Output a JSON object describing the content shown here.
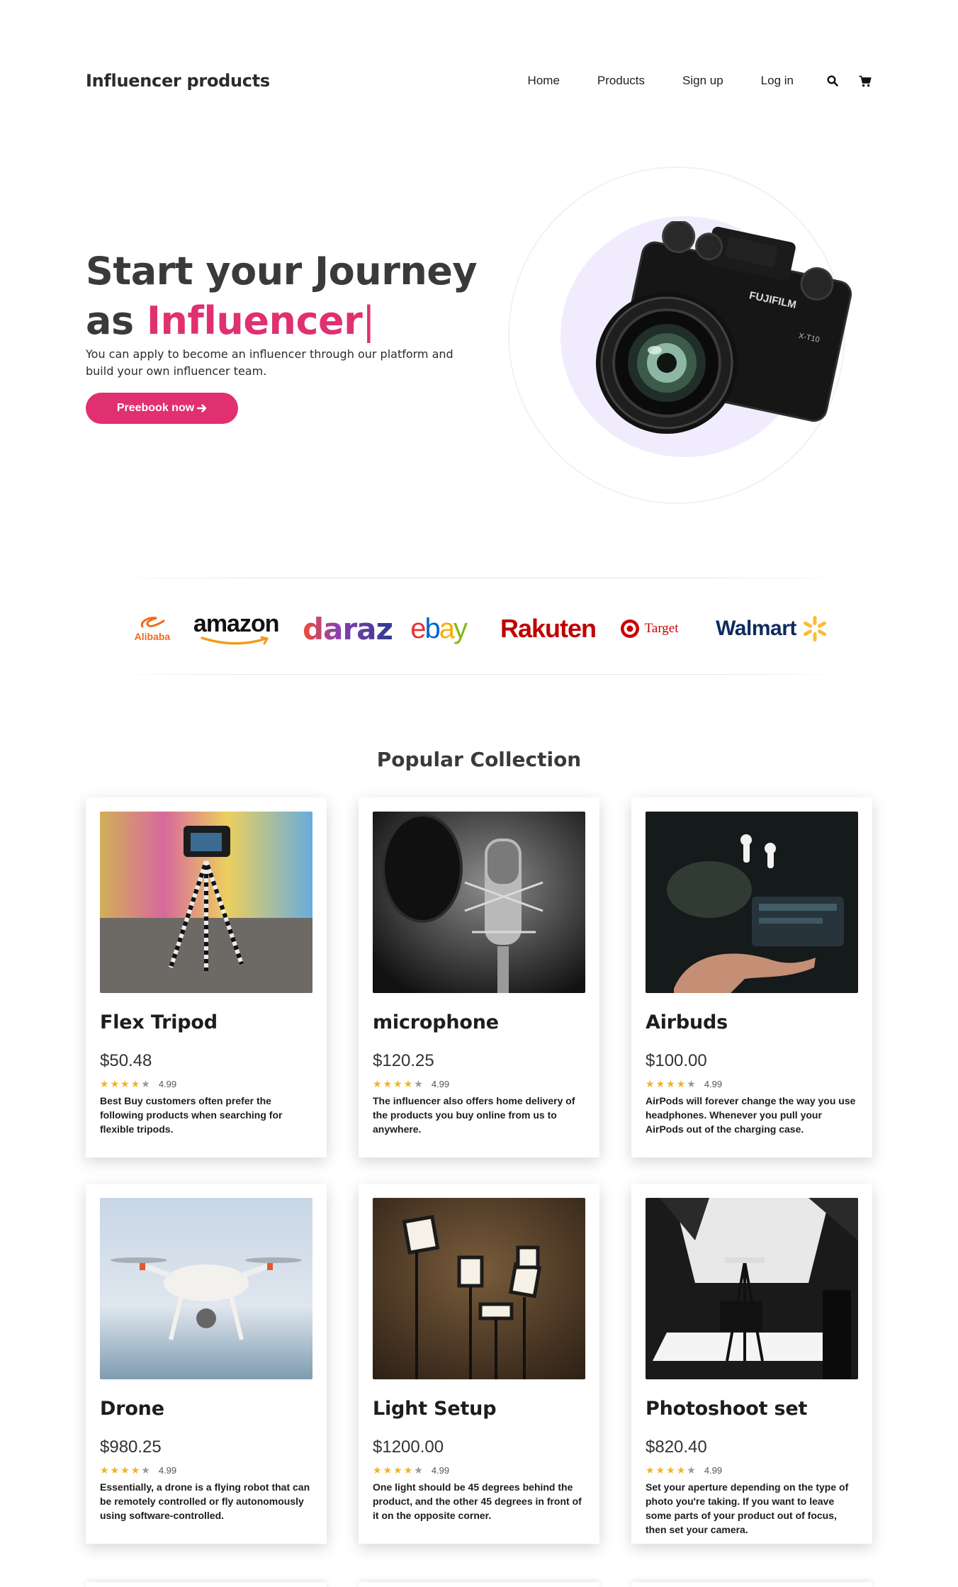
{
  "nav": {
    "brand": "Influencer products",
    "links": [
      "Home",
      "Products",
      "Sign up",
      "Log in"
    ],
    "icons": [
      "search-icon",
      "cart-icon"
    ]
  },
  "hero": {
    "title_line1": "Start your Journey",
    "title_line2_prefix": "as ",
    "title_accent": "Influencer",
    "cursor": "|",
    "subtitle": "You can apply to become an influencer through our platform and build your own influencer team.",
    "button_label": "Preebook now",
    "image": "camera-image"
  },
  "brands": {
    "alibaba": "Alibaba",
    "amazon": "amazon",
    "daraz": "daraz",
    "ebay": "ebay",
    "rakuten": "Rakuten",
    "target": "Target",
    "walmart": "Walmart"
  },
  "collection": {
    "title": "Popular Collection",
    "products": [
      {
        "name": "Flex Tripod",
        "price": "$50.48",
        "rating": "4.99",
        "stars": 4,
        "description": "Best Buy customers often prefer the following products when searching for flexible tripods."
      },
      {
        "name": "microphone",
        "price": "$120.25",
        "rating": "4.99",
        "stars": 4,
        "description": "The influencer also offers home delivery of the products you buy online from us to anywhere."
      },
      {
        "name": "Airbuds",
        "price": "$100.00",
        "rating": "4.99",
        "stars": 4,
        "description": "AirPods will forever change the way you use headphones. Whenever you pull your AirPods out of the charging case."
      },
      {
        "name": "Drone",
        "price": "$980.25",
        "rating": "4.99",
        "stars": 4,
        "description": "Essentially, a drone is a flying robot that can be remotely controlled or fly autonomously using software-controlled."
      },
      {
        "name": "Light Setup",
        "price": "$1200.00",
        "rating": "4.99",
        "stars": 4,
        "description": "One light should be 45 degrees behind the product, and the other 45 degrees in front of it on the opposite corner."
      },
      {
        "name": "Photoshoot set",
        "price": "$820.40",
        "rating": "4.99",
        "stars": 4,
        "description": "Set your aperture depending on the type of photo you're taking. If you want to leave some parts of your product out of focus, then set your camera."
      }
    ]
  },
  "colors": {
    "accent": "#e0306f",
    "heading": "#3a3a3a",
    "star": "#f6b21a"
  }
}
